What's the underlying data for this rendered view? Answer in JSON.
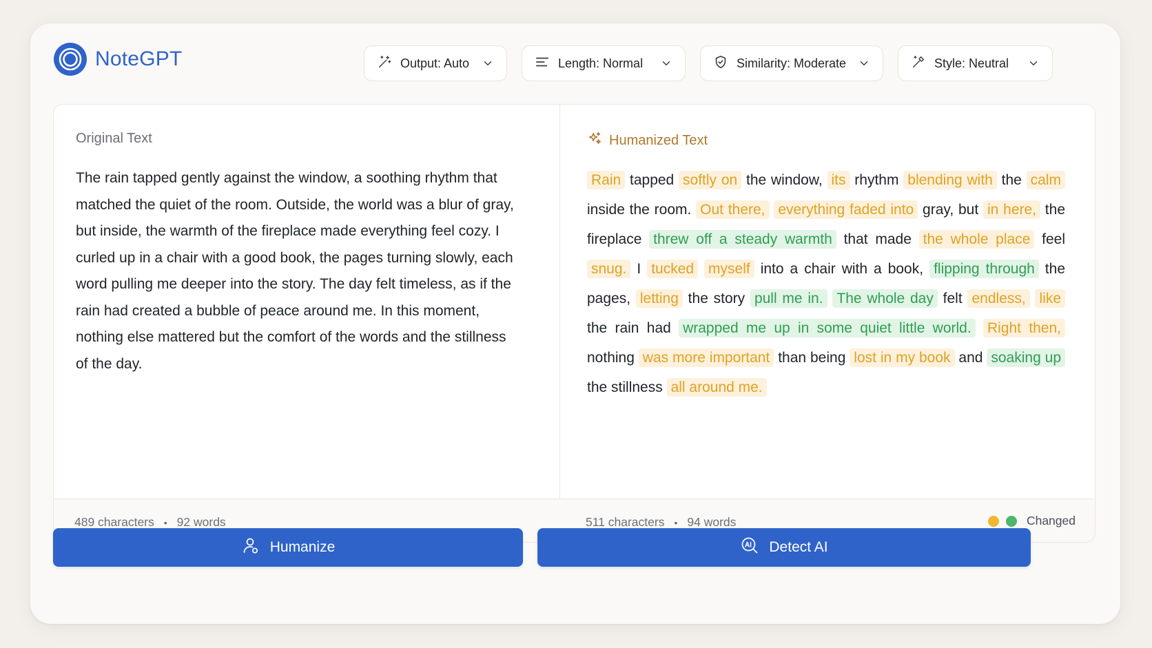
{
  "app": {
    "name": "NoteGPT"
  },
  "toolbar": {
    "output": "Output: Auto",
    "length": "Length: Normal",
    "similarity": "Similarity: Moderate",
    "style": "Style: Neutral"
  },
  "original": {
    "title": "Original Text",
    "text": "The rain tapped gently against the window, a soothing rhythm that matched the quiet of the room. Outside, the world was a blur of gray, but inside, the warmth of the fireplace made everything feel cozy. I curled up in a chair with a good book, the pages turning slowly, each word pulling me deeper into the story. The day felt timeless, as if the rain had created a bubble of peace around me. In this moment, nothing else mattered but the comfort of the words and the stillness of the day.",
    "characters": "489 characters",
    "words": "92 words"
  },
  "humanized": {
    "title": "Humanized Text",
    "segments": [
      {
        "t": "Rain",
        "h": "y"
      },
      {
        "t": " tapped "
      },
      {
        "t": "softly on",
        "h": "y"
      },
      {
        "t": " the window, "
      },
      {
        "t": "its",
        "h": "y"
      },
      {
        "t": " rhythm "
      },
      {
        "t": "blending with",
        "h": "y"
      },
      {
        "t": " the "
      },
      {
        "t": "calm",
        "h": "y"
      },
      {
        "t": " inside the room. "
      },
      {
        "t": "Out there,",
        "h": "y"
      },
      {
        "t": " "
      },
      {
        "t": "everything faded into",
        "h": "y"
      },
      {
        "t": " gray, but "
      },
      {
        "t": "in here,",
        "h": "y"
      },
      {
        "t": " the fireplace "
      },
      {
        "t": "threw off a steady warmth",
        "h": "g"
      },
      {
        "t": " that made "
      },
      {
        "t": "the whole place",
        "h": "y"
      },
      {
        "t": " feel "
      },
      {
        "t": "snug.",
        "h": "y"
      },
      {
        "t": " I "
      },
      {
        "t": "tucked",
        "h": "y"
      },
      {
        "t": " "
      },
      {
        "t": "myself",
        "h": "y"
      },
      {
        "t": " into a chair with a book, "
      },
      {
        "t": "flipping through",
        "h": "g"
      },
      {
        "t": " the pages, "
      },
      {
        "t": "letting",
        "h": "y"
      },
      {
        "t": " the story "
      },
      {
        "t": "pull me in.",
        "h": "g"
      },
      {
        "t": " "
      },
      {
        "t": "The whole day",
        "h": "g"
      },
      {
        "t": " felt "
      },
      {
        "t": "endless,",
        "h": "y"
      },
      {
        "t": " "
      },
      {
        "t": "like",
        "h": "y"
      },
      {
        "t": " the rain had "
      },
      {
        "t": "wrapped me up in some quiet little world.",
        "h": "g"
      },
      {
        "t": " "
      },
      {
        "t": "Right then,",
        "h": "y"
      },
      {
        "t": " nothing "
      },
      {
        "t": "was more important",
        "h": "y"
      },
      {
        "t": " than being "
      },
      {
        "t": "lost in my book",
        "h": "y"
      },
      {
        "t": " and "
      },
      {
        "t": "soaking up",
        "h": "g"
      },
      {
        "t": " the stillness "
      },
      {
        "t": "all around me.",
        "h": "y"
      }
    ],
    "characters": "511 characters",
    "words": "94 words",
    "legend_label": "Changed"
  },
  "colors": {
    "accent": "#2f63c9",
    "highlight_yellow": "#e0a224",
    "highlight_green": "#2f9e55",
    "legend_yellow": "#f4b531",
    "legend_green": "#4cb66c"
  },
  "actions": {
    "humanize": "Humanize",
    "detect": "Detect AI"
  },
  "icons": {
    "logo": "notegpt-logo-icon",
    "output": "magic-wand-sparkle-icon",
    "length": "text-lines-icon",
    "similarity": "shield-check-icon",
    "style": "pen-wand-icon",
    "humanized_title": "sparkle-icon",
    "humanize_button": "user-icon",
    "detect_button": "ai-magnifier-icon"
  }
}
